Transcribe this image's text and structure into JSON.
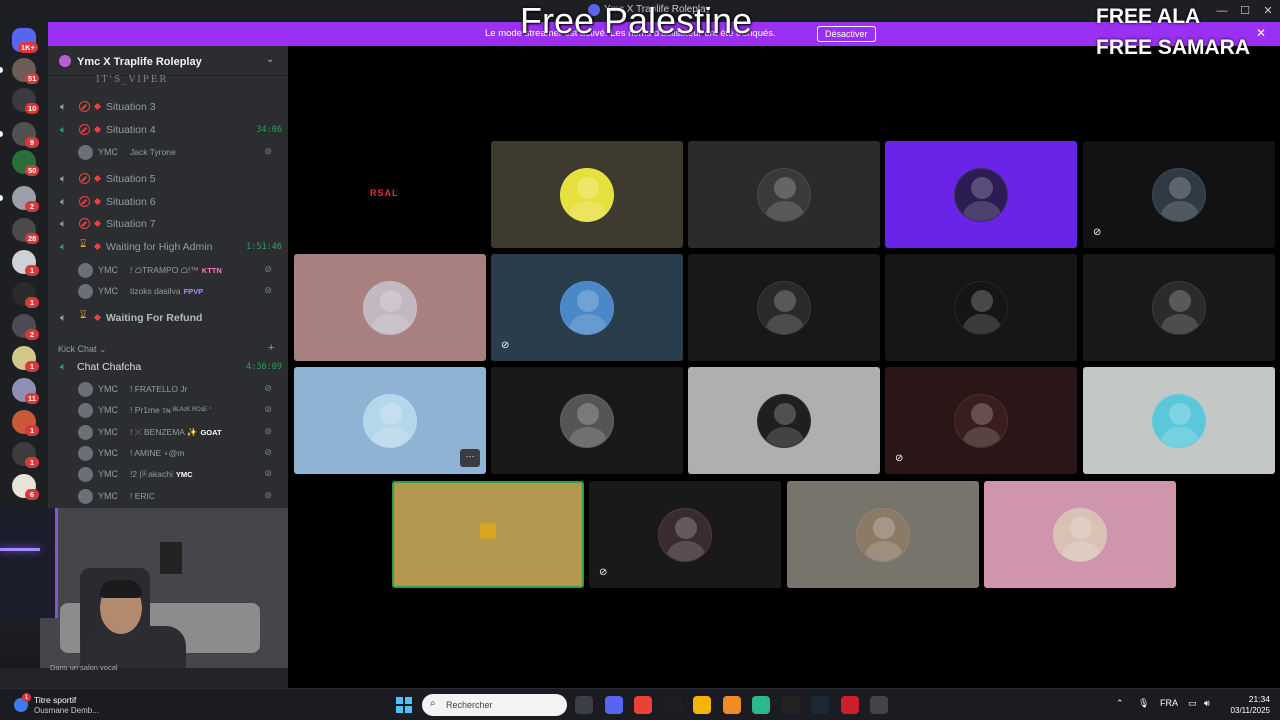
{
  "window": {
    "title": "Ymc X Traplife Roleplay"
  },
  "overlay": {
    "free_palestine": "Free Palestine",
    "free_ala": "FREE ALA",
    "free_samara": "FREE SAMARA"
  },
  "banner": {
    "message": "Le mode streamer est activé. Les noms d'utilisateur ont été tronqués.",
    "button": "Désactiver"
  },
  "rail": {
    "home_badge": "1K+",
    "badges": [
      "51",
      "10",
      "9",
      "50",
      "2",
      "28",
      "1",
      "1",
      "2",
      "1",
      "11",
      "1",
      "1",
      "6"
    ]
  },
  "server": {
    "name": "Ymc X Traplife Roleplay"
  },
  "sidebar": {
    "cut_text": "IT'S_VIPER",
    "channels": [
      {
        "label": "Situation 3",
        "state": "dnd",
        "timer": ""
      },
      {
        "label": "Situation 4",
        "state": "dnd",
        "timer": "34:06"
      },
      {
        "label": "Situation 5",
        "state": "dnd",
        "timer": ""
      },
      {
        "label": "Situation 6",
        "state": "dnd",
        "timer": ""
      },
      {
        "label": "Situation 7",
        "state": "dnd",
        "timer": ""
      },
      {
        "label": "Waiting for High Admin",
        "state": "waiting",
        "timer": "1:51:46"
      },
      {
        "label": "Waiting For Refund",
        "state": "waiting",
        "timer": ""
      }
    ],
    "users_sit4": [
      {
        "tag": "YMC",
        "name": "Jack Tyrone"
      }
    ],
    "users_waiting": [
      {
        "tag": "YMC",
        "name": "! ᜊTRAMPO ᜊ!™",
        "role": "KTTN"
      },
      {
        "tag": "YMC",
        "name": "tizoks dasilva",
        "role": "FPVP"
      }
    ],
    "category": "Kick Chat",
    "chat_channel": {
      "label": "Chat Chafcha",
      "timer": "4:36:09"
    },
    "users_chat": [
      {
        "tag": "YMC",
        "name": "! FRATELLO Jr",
        "role": ""
      },
      {
        "tag": "YMC",
        "name": "! Pr1me ᴛɴ ᴮᴸᴬᶜᴷ ᴿᴼˢᴱ '",
        "role": ""
      },
      {
        "tag": "YMC",
        "name": "! ⤫ BENZEMA ✨",
        "role": "GOAT"
      },
      {
        "tag": "YMC",
        "name": "! AMINE ⍣@m",
        "role": ""
      },
      {
        "tag": "YMC",
        "name": "!2 |ꀘakachi",
        "role": "YMC"
      },
      {
        "tag": "YMC",
        "name": "! ERIC",
        "role": ""
      }
    ]
  },
  "webcam": {
    "status": "Dans un salon vocal"
  },
  "grid": {
    "tile_colors": [
      "#000000",
      "#3e3b2e",
      "#2b2b2b",
      "#6a24e8",
      "#121212",
      "#a8807f",
      "#2a3d4d",
      "#181818",
      "#161616",
      "#181818",
      "#8fb3d4",
      "#191919",
      "#aeb0ad",
      "#2a1616",
      "#c3c7c6",
      "#b5984f",
      "#191919",
      "#77746c",
      "#cf95ad"
    ],
    "avatar_colors": [
      "#000000",
      "#e6e03f",
      "#3a3a3a",
      "#2b1d54",
      "#2f3a44",
      "#c2b8c2",
      "#4a88c8",
      "#2a2a2a",
      "#151515",
      "#2b2b2b",
      "#b5d7ea",
      "#555555",
      "#1f1f1f",
      "#3a1e1e",
      "#5bc7da",
      "#b5984f",
      "#3a2b33",
      "#8a7a66",
      "#d8c1b5"
    ],
    "rsal_label": "RSAL",
    "more_label": "···"
  },
  "taskbar": {
    "widget_title": "Titre sportif",
    "widget_sub": "Ousmane Demb...",
    "widget_badge": "1",
    "search_placeholder": "Rechercher",
    "lang": "FRA",
    "time": "21:34",
    "date": "03/11/2025",
    "app_colors": [
      "#3b3f46",
      "#5865f2",
      "#ea4335",
      "#1f1f1f",
      "#f4b400",
      "#f08a24",
      "#2ab88f",
      "#222222",
      "#1b2838",
      "#cc1f2d",
      "#444444"
    ]
  }
}
